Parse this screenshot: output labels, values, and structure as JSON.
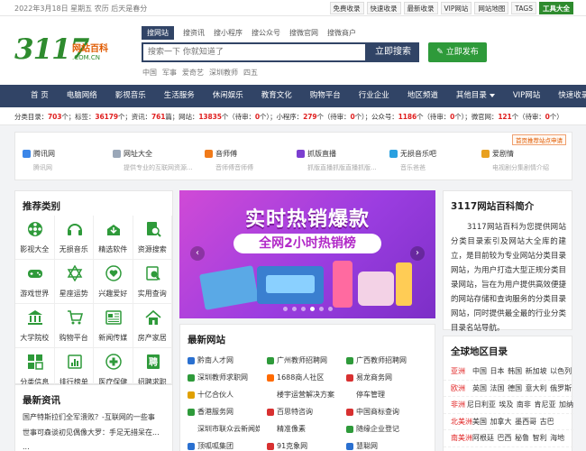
{
  "topbar": {
    "date": "2022年3月18日 星期五 农历 后天是春分",
    "links": [
      "免费收录",
      "快速收录",
      "最新收录",
      "VIP网站",
      "网站地图",
      "TAGS",
      "工具大全"
    ]
  },
  "logo": {
    "number": "3117",
    "cn": "网站百科",
    "en": ".COM.CN"
  },
  "search": {
    "tabs": [
      "搜网站",
      "搜资讯",
      "搜小程序",
      "搜公众号",
      "搜微官网",
      "搜微商户"
    ],
    "placeholder": "搜索一下 你就知道了",
    "button": "立即搜索",
    "publish": "立即发布",
    "hot": [
      "中国",
      "军事",
      "爱奇艺",
      "深圳教师",
      "四五"
    ]
  },
  "nav": [
    "首 页",
    "电脑网络",
    "影视音乐",
    "生活服务",
    "休闲娱乐",
    "教育文化",
    "购物平台",
    "行业企业",
    "地区频道",
    "其他目录",
    "VIP网站",
    "快速收录"
  ],
  "stats": {
    "s1": "分类目录：",
    "n1": "703",
    "s2": "个；标签：",
    "n2": "36179",
    "s3": "个；资讯：",
    "n3": "761",
    "s4": "篇；网站：",
    "n4": "13835",
    "s5": "个（待审：",
    "n5": "0",
    "s6": "个）；小程序：",
    "n6": "279",
    "s7": "个（待审：",
    "n7": "0",
    "s8": "个）；公众号：",
    "n8": "1186",
    "s9": "个（待审：",
    "n9": "0",
    "s10": "个）；微官网：",
    "n10": "121",
    "s11": "个（待审：",
    "n11": "0",
    "s12": "个）"
  },
  "featured": {
    "tag": "首页推荐站点申请",
    "items": [
      {
        "name": "腾讯网",
        "desc": "腾讯网",
        "color": "#3b86e8"
      },
      {
        "name": "网址大全",
        "desc": "提供专业的互联网资源...",
        "color": "#9aa7b8"
      },
      {
        "name": "音师傅",
        "desc": "音师傅音师傅",
        "color": "#f07a1a"
      },
      {
        "name": "抓版直播",
        "desc": "抓版直播抓版直播抓版...",
        "color": "#7b3fd0"
      },
      {
        "name": "无损音乐吧",
        "desc": "音乐爸爸",
        "color": "#2aa0e0"
      },
      {
        "name": "爱剧情",
        "desc": "电视剧分集剧情介绍",
        "color": "#e8a020"
      }
    ]
  },
  "recommend": {
    "title": "推荐类别",
    "items": [
      "影视大全",
      "无损音乐",
      "精选软件",
      "资源搜索",
      "游戏世界",
      "星座运势",
      "兴趣爱好",
      "实用查询",
      "大学院校",
      "购物平台",
      "新闻传媒",
      "房产家居",
      "分类信息",
      "排行榜单",
      "医疗保健",
      "招聘求职"
    ],
    "icon_color": "#2e9a3a"
  },
  "banner": {
    "title": "实时热销爆款",
    "subtitle": "全网2小时热销榜"
  },
  "latest": {
    "title": "最新网站",
    "sites": [
      {
        "name": "黔南人才网",
        "color": "#2a70d0"
      },
      {
        "name": "广州教师招聘网",
        "color": "#2e9a3a"
      },
      {
        "name": "广西教师招聘网",
        "color": "#2e9a3a"
      },
      {
        "name": "深圳教师求职网",
        "color": "#2e9a3a"
      },
      {
        "name": "1688商人社区",
        "color": "#ff6a00"
      },
      {
        "name": "易龙商务网",
        "color": "#d83030"
      },
      {
        "name": "十亿合伙人",
        "color": "#e0a000"
      },
      {
        "name": "楼宇运营解决方案",
        "color": ""
      },
      {
        "name": "停车管理",
        "color": ""
      },
      {
        "name": "香港服务网",
        "color": "#2e9a3a"
      },
      {
        "name": "百思特咨询",
        "color": "#d83030"
      },
      {
        "name": "中国商标查询",
        "color": "#d83030"
      },
      {
        "name": "深圳市联众云新闻媒...",
        "color": ""
      },
      {
        "name": "精准像素",
        "color": ""
      },
      {
        "name": "随缘企业登记",
        "color": "#2e9a3a"
      },
      {
        "name": "顶呱呱集团",
        "color": "#2a70d0"
      },
      {
        "name": "91克象网",
        "color": "#d83030"
      },
      {
        "name": "慧聪网",
        "color": "#2a70d0"
      }
    ]
  },
  "intro": {
    "title": "3117网站百科简介",
    "text": "3117网站百科为您提供网站分类目录索引及网站大全库的建立，是目前较为专业网站分类目录网站，为用户打造大型正规分类目录网站，旨在为用户提供高效便捷的网站存储和查询服务的分类目录网站，同时提供最全最的行业分类目录名站导航。"
  },
  "regions": {
    "title": "全球地区目录",
    "rows": [
      {
        "name": "亚洲",
        "countries": "中国 日本 韩国 新加坡 以色列"
      },
      {
        "name": "欧洲",
        "countries": "英国 法国 德国 意大利 俄罗斯"
      },
      {
        "name": "非洲",
        "countries": "尼日利亚 埃及 南非 肯尼亚 加纳"
      },
      {
        "name": "北美洲",
        "countries": "美国 加拿大 墨西哥 古巴"
      },
      {
        "name": "南美洲",
        "countries": "阿根廷 巴西 秘鲁 智利 海地"
      }
    ]
  },
  "news": {
    "title": "最新资讯",
    "items": [
      "国产特斯拉们全军溃败？-互联网的一些事",
      "世事可森谈初见偶像大罗：手足无措呆在...",
      "..."
    ]
  }
}
